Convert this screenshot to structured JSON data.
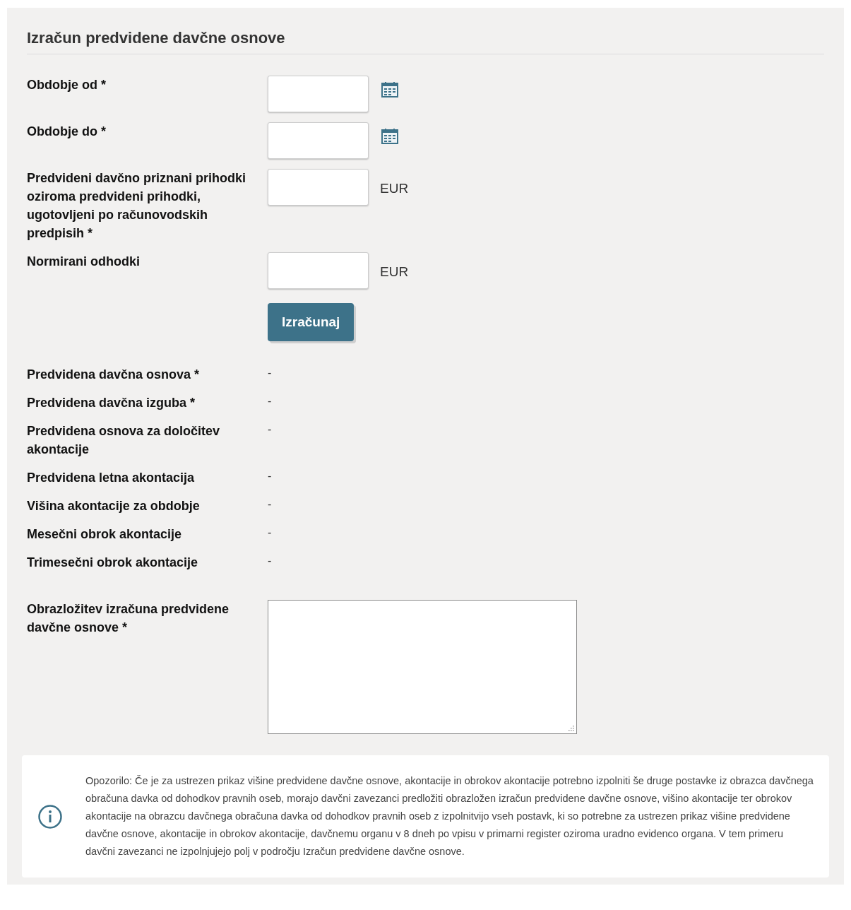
{
  "title": "Izračun predvidene davčne osnove",
  "fields": [
    {
      "label": "Obdobje od *",
      "kind": "date"
    },
    {
      "label": "Obdobje do *",
      "kind": "date"
    },
    {
      "label": "Predvideni davčno priznani prihodki oziroma predvideni prihodki, ugotovljeni po računovodskih predpisih *",
      "kind": "amount",
      "unit": "EUR"
    },
    {
      "label": "Normirani odhodki",
      "kind": "amount",
      "unit": "EUR"
    }
  ],
  "button": "Izračunaj",
  "results": [
    {
      "label": "Predvidena davčna osnova *",
      "value": "-"
    },
    {
      "label": "Predvidena davčna izguba *",
      "value": "-"
    },
    {
      "label": "Predvidena osnova za določitev akontacije",
      "value": "-"
    },
    {
      "label": "Predvidena letna akontacija",
      "value": "-"
    },
    {
      "label": "Višina akontacije za obdobje",
      "value": "-"
    },
    {
      "label": "Mesečni obrok akontacije",
      "value": "-"
    },
    {
      "label": "Trimesečni obrok akontacije",
      "value": "-"
    }
  ],
  "explanation": {
    "label": "Obrazložitev izračuna predvidene davčne osnove *"
  },
  "notice": "Opozorilo: Če je za ustrezen prikaz višine predvidene davčne osnove, akontacije in obrokov akontacije potrebno izpolniti še druge postavke iz obrazca davčnega obračuna davka od dohodkov pravnih oseb, morajo davčni zavezanci predložiti obrazložen izračun predvidene davčne osnove, višino akontacije ter obrokov akontacije na obrazcu davčnega obračuna davka od dohodkov pravnih oseb z izpolnitvijo vseh postavk, ki so potrebne za ustrezen prikaz višine predvidene davčne osnove, akontacije in obrokov akontacije, davčnemu organu v 8 dneh po vpisu v primarni register oziroma uradno evidenco organa. V tem primeru davčni zavezanci ne izpolnjujejo polj v področju Izračun predvidene davčne osnove."
}
